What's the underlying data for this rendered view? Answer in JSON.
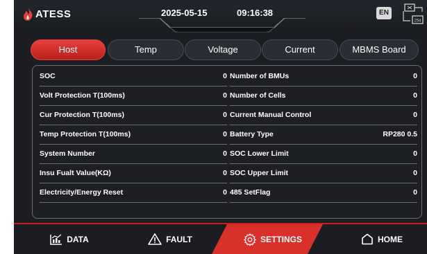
{
  "header": {
    "logo_text": "ATESS",
    "date": "2025-05-15",
    "time": "09:16:38",
    "language": "EN",
    "network_label": "254"
  },
  "tabs": [
    {
      "label": "Host",
      "active": true
    },
    {
      "label": "Temp",
      "active": false
    },
    {
      "label": "Voltage",
      "active": false
    },
    {
      "label": "Current",
      "active": false
    },
    {
      "label": "MBMS Board",
      "active": false
    }
  ],
  "left_rows": [
    {
      "label": "SOC",
      "value": "0"
    },
    {
      "label": "Volt Protection T(100ms)",
      "value": "0"
    },
    {
      "label": "Cur Protection T(100ms)",
      "value": "0"
    },
    {
      "label": "Temp Protection T(100ms)",
      "value": "0"
    },
    {
      "label": "System Number",
      "value": "0"
    },
    {
      "label": "Insu Fualt Value(KΩ)",
      "value": "0"
    },
    {
      "label": "Electricity/Energy Reset",
      "value": "0"
    }
  ],
  "right_rows": [
    {
      "label": "Number of BMUs",
      "value": "0"
    },
    {
      "label": "Number of Cells",
      "value": "0"
    },
    {
      "label": "Current Manual Control",
      "value": "0"
    },
    {
      "label": "Battery Type",
      "value": "RP280 0.5"
    },
    {
      "label": "SOC Lower Limit",
      "value": "0"
    },
    {
      "label": "SOC Upper Limit",
      "value": "0"
    },
    {
      "label": "485 SetFlag",
      "value": "0"
    }
  ],
  "bottom_nav": [
    {
      "label": "DATA",
      "icon": "chart-icon",
      "active": false
    },
    {
      "label": "FAULT",
      "icon": "warning-icon",
      "active": false
    },
    {
      "label": "SETTINGS",
      "icon": "gear-icon",
      "active": true
    },
    {
      "label": "HOME",
      "icon": "home-icon",
      "active": false
    }
  ],
  "colors": {
    "accent": "#d8302b",
    "background": "#1b1d22",
    "panel_border": "#6a6d73"
  }
}
